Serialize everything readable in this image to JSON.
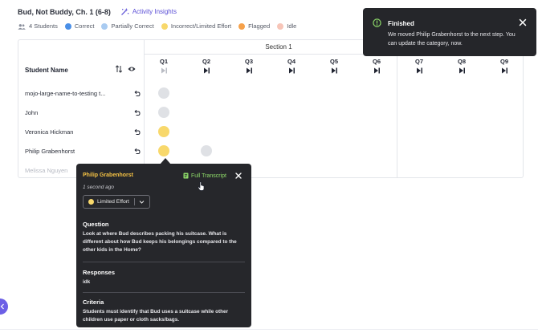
{
  "header": {
    "assignment_title": "Bud, Not Buddy, Ch. 1 (6-8)",
    "activity_insights": "Activity Insights",
    "icon": "sparkle-wand-icon"
  },
  "legend": {
    "students_count": "4 Students",
    "items": [
      {
        "label": "Correct",
        "color": "#4a8fe7"
      },
      {
        "label": "Partially Correct",
        "color": "#a9cbf1"
      },
      {
        "label": "Incorrect/Limited Effort",
        "color": "#f8d86b"
      },
      {
        "label": "Flagged",
        "color": "#f6a14a"
      },
      {
        "label": "Idle",
        "color": "#f7c5b8"
      }
    ]
  },
  "table": {
    "section_label": "Section 1",
    "student_col_header": "Student Name",
    "questions": [
      "Q1",
      "Q2",
      "Q3",
      "Q4",
      "Q5",
      "Q6",
      "Q7",
      "Q8",
      "Q9"
    ],
    "students": [
      {
        "name": "mojo-large-name-to-testing t...",
        "answers": [
          "idle-gray",
          null,
          null,
          null,
          null,
          null,
          null,
          null,
          null
        ]
      },
      {
        "name": "John",
        "answers": [
          "idle-gray",
          null,
          null,
          null,
          null,
          null,
          null,
          null,
          null
        ]
      },
      {
        "name": "Veronica Hickman",
        "answers": [
          "yellow",
          null,
          null,
          null,
          null,
          null,
          null,
          null,
          null
        ]
      },
      {
        "name": "Philip Grabenhorst",
        "answers": [
          "yellow",
          "idle-gray",
          null,
          null,
          null,
          null,
          null,
          null,
          null
        ]
      },
      {
        "name": "Melissa Nguyen",
        "answers": [
          null,
          null,
          null,
          null,
          null,
          null,
          null,
          null,
          null
        ]
      }
    ],
    "cell_colors": {
      "idle-gray": "#dfe1e5",
      "yellow": "#f8d86b"
    }
  },
  "popover": {
    "student_name": "Philip Grabenhorst",
    "timestamp": "1 second ago",
    "full_transcript": "Full Transcript",
    "selected_category": "Limited Effort",
    "selected_color": "#f8d86b",
    "question_label": "Question",
    "question_text": "Look at where Bud describes packing his suitcase. What is different about how Bud keeps his belongings compared to the other kids in the Home?",
    "responses_label": "Responses",
    "response_text": "idk",
    "criteria_label": "Criteria",
    "criteria_text": "Students must identify that Bud uses a suitcase while other children use paper or cloth sacks/bags."
  },
  "toast": {
    "title": "Finished",
    "message": "We moved Philip Grabenhorst to the next step. You can update the category, now."
  }
}
